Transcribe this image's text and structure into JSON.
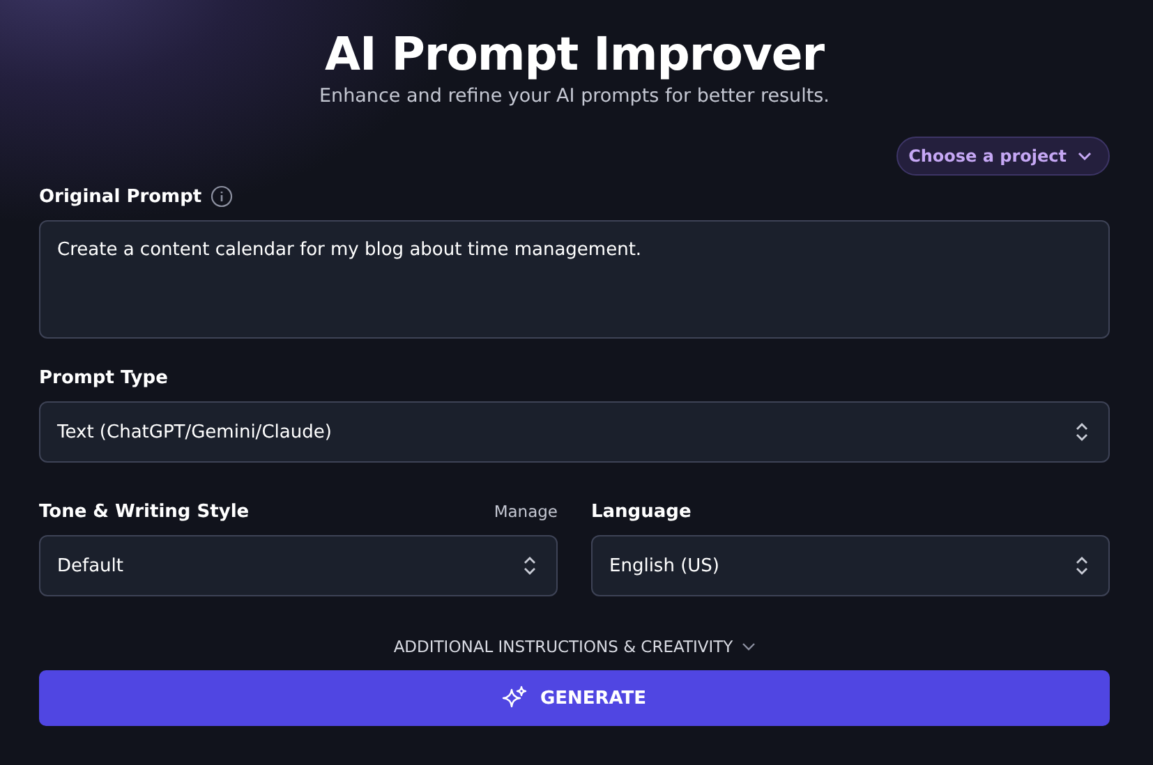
{
  "header": {
    "title": "AI Prompt Improver",
    "subtitle": "Enhance and refine your AI prompts for better results."
  },
  "project_button": {
    "label": "Choose a project"
  },
  "original_prompt": {
    "label": "Original Prompt",
    "value": "Create a content calendar for my blog about time management."
  },
  "prompt_type": {
    "label": "Prompt Type",
    "value": "Text (ChatGPT/Gemini/Claude)"
  },
  "tone": {
    "label": "Tone & Writing Style",
    "link": "Manage",
    "value": "Default"
  },
  "language": {
    "label": "Language",
    "value": "English (US)"
  },
  "additional": {
    "label": "ADDITIONAL INSTRUCTIONS & CREATIVITY",
    "expanded": false
  },
  "generate_button": {
    "label": "GENERATE"
  }
}
